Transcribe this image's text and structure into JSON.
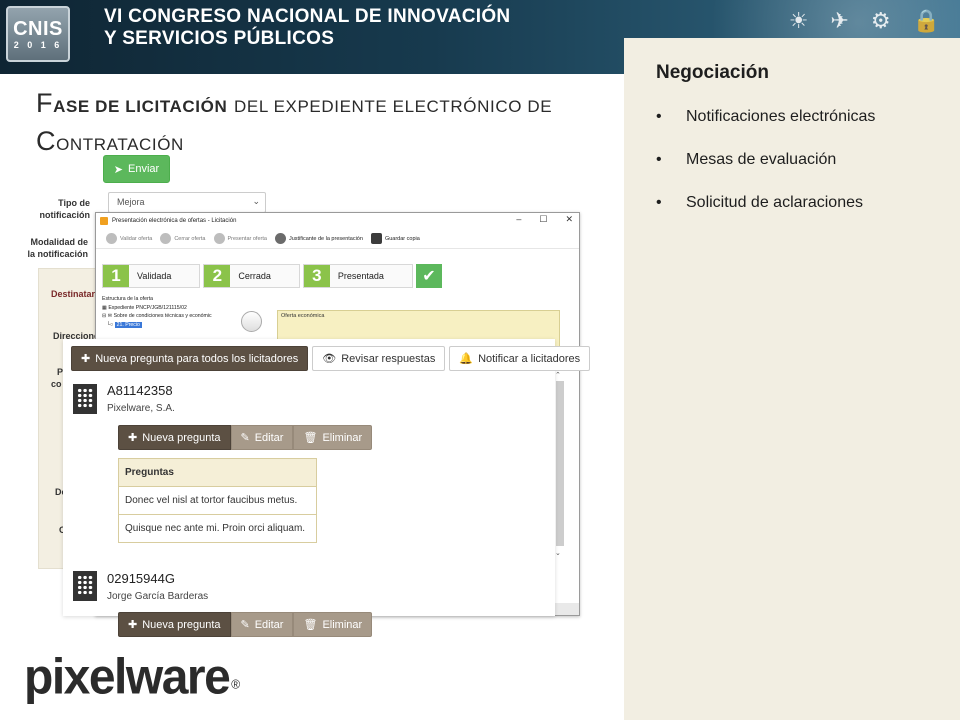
{
  "banner": {
    "badge_top": "CNIS",
    "badge_year": "2 0 1 6",
    "title_line1": "VI CONGRESO NACIONAL DE INNOVACIÓN",
    "title_line2": "Y SERVICIOS PÚBLICOS",
    "icons": [
      "sun-icon",
      "plane-icon",
      "gear-icon",
      "lock-icon"
    ]
  },
  "slide": {
    "title_part1_cap": "F",
    "title_part1_rest": "ase de licitación",
    "title_part2": "del expediente electrónico de",
    "title_part3_cap": "C",
    "title_part3_rest": "ontratación"
  },
  "side_panel": {
    "heading": "Negociación",
    "items": [
      {
        "label": "Notificaciones electrónicas"
      },
      {
        "label": "Mesas de evaluación"
      },
      {
        "label": "Solicitud de aclaraciones"
      }
    ]
  },
  "form": {
    "send_label": "Enviar",
    "label_tipo_1": "Tipo de",
    "label_tipo_2": "notificación",
    "label_modalidad_1": "Modalidad de",
    "label_modalidad_2": "la notificación",
    "tipo_value": "Mejora",
    "dest_label": "Destinatari",
    "side_frag_1": "Direccione",
    "side_frag_2": "P",
    "side_frag_3": "co",
    "side_frag_4": "Do",
    "side_frag_5": "C"
  },
  "window": {
    "title": "Presentación electrónica de ofertas - Licitación",
    "toolbar": [
      {
        "label": "Validar oferta"
      },
      {
        "label": "Cerrar oferta"
      },
      {
        "label": "Presentar oferta"
      },
      {
        "label": "Justificante de la presentación"
      },
      {
        "label": "Guardar copia"
      }
    ],
    "steps": [
      {
        "num": "1",
        "label": "Validada"
      },
      {
        "num": "2",
        "label": "Cerrada"
      },
      {
        "num": "3",
        "label": "Presentada"
      }
    ],
    "tree_title": "Estructura de la oferta",
    "tree_item_1": "Expediente PNCP/JGB/121115/02",
    "tree_item_2": "Sobre de condiciones técnicas y económic",
    "tree_item_3": "21. Precio",
    "offer_box_label": "Oferta económica"
  },
  "qa": {
    "toolbar": {
      "new_all": "Nueva pregunta para todos los licitadores",
      "review": "Revisar respuestas",
      "notify": "Notificar a licitadores"
    },
    "bidders": [
      {
        "id": "A81142358",
        "name": "Pixelware, S.A."
      },
      {
        "id": "02915944G",
        "name": "Jorge García Barderas"
      }
    ],
    "actions": {
      "new": "Nueva pregunta",
      "edit": "Editar",
      "delete": "Eliminar"
    },
    "questions_header": "Preguntas",
    "questions": [
      "Donec vel nisl at tortor faucibus metus.",
      "Quisque nec ante mi. Proin orci aliquam."
    ]
  },
  "footer": {
    "logo": "pixelware",
    "logo_mark": "®"
  }
}
